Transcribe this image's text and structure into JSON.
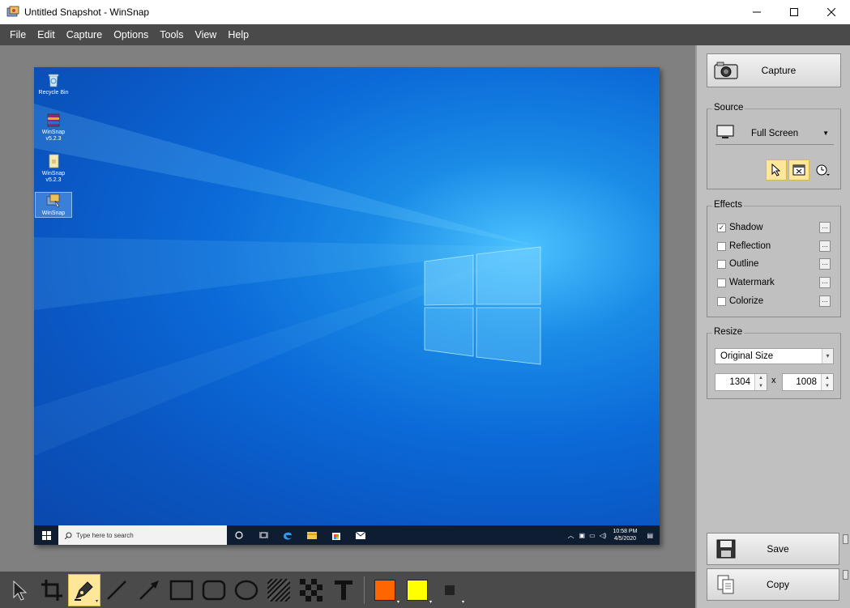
{
  "window": {
    "title": "Untitled Snapshot - WinSnap",
    "controls": [
      "minimize-icon",
      "maximize-icon",
      "close-icon"
    ]
  },
  "menu": {
    "items": [
      "File",
      "Edit",
      "Capture",
      "Options",
      "Tools",
      "View",
      "Help"
    ]
  },
  "screenshot": {
    "desktop_icons": [
      {
        "label": "Recycle Bin",
        "icon": "recycle-bin-icon"
      },
      {
        "label": "WinSnap v5.2.3",
        "icon": "archive-icon"
      },
      {
        "label": "WinSnap v5.2.3",
        "icon": "folder-icon"
      },
      {
        "label": "WinSnap",
        "icon": "winsnap-icon"
      }
    ],
    "taskbar": {
      "search_placeholder": "Type here to search",
      "time": "10:58 PM",
      "date": "4/5/2020"
    }
  },
  "panel": {
    "capture_label": "Capture",
    "source": {
      "legend": "Source",
      "selected": "Full Screen"
    },
    "effects": {
      "legend": "Effects",
      "items": [
        {
          "label": "Shadow",
          "checked": true
        },
        {
          "label": "Reflection",
          "checked": false
        },
        {
          "label": "Outline",
          "checked": false
        },
        {
          "label": "Watermark",
          "checked": false
        },
        {
          "label": "Colorize",
          "checked": false
        }
      ]
    },
    "resize": {
      "legend": "Resize",
      "mode": "Original Size",
      "width": "1304",
      "height": "1008",
      "separator": "x"
    },
    "save_label": "Save",
    "copy_label": "Copy"
  },
  "toolbar": {
    "tools": [
      "select-arrow-icon",
      "crop-icon",
      "pen-icon",
      "line-icon",
      "arrow-icon",
      "rectangle-icon",
      "rounded-rectangle-icon",
      "ellipse-icon",
      "hatch-icon",
      "pixelate-icon",
      "text-icon"
    ],
    "active_tool": "pen-icon",
    "colors": {
      "primary": "#ff6600",
      "secondary": "#ffff00",
      "accent_highlight": "#ffe79a"
    }
  }
}
